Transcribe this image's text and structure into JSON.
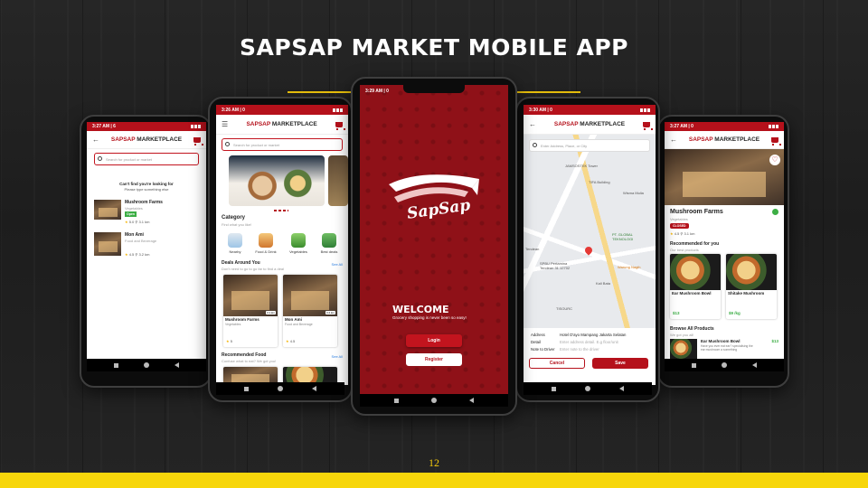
{
  "slide": {
    "title": "SAPSAP MARKET MOBILE APP",
    "page_number": "12",
    "colors": {
      "accent": "#f7d60b",
      "brand_red": "#b5111b",
      "background": "#222222"
    }
  },
  "phone1": {
    "time": "3:27 AM | 6",
    "app_title_red": "SAPSAP",
    "app_title_rest": " MARKETPLACE",
    "search_placeholder": "Search for product or market",
    "empty_title": "Can't find you're looking for",
    "empty_subtitle": "Please type something else",
    "results": [
      {
        "name": "Mushroom Farms",
        "category": "Vegetables",
        "status": "Open",
        "rating": "5.0",
        "distance": "3.1 km"
      },
      {
        "name": "Mon Ami",
        "category": "Food and Beverage",
        "rating": "4.5",
        "distance": "3.2 km"
      }
    ]
  },
  "phone2": {
    "time": "3:26 AM | 0",
    "app_title_red": "SAPSAP",
    "app_title_rest": " MARKETPLACE",
    "search_placeholder": "Search for product or market",
    "category_title": "Category",
    "category_subtitle": "Find what you like!",
    "categories": [
      "Nearby",
      "Food & Drink",
      "Vegetables",
      "Best deals"
    ],
    "deals_title": "Deals Around You",
    "deals_subtitle": "Don't need to go to go far to find a deal",
    "see_all": "See All",
    "deals": [
      {
        "name": "Mushroom Farms",
        "category": "Vegetables",
        "rating": "5",
        "distance": "3.1 km"
      },
      {
        "name": "Mon Ami",
        "category": "Food and Beverage",
        "rating": "4.5",
        "distance": "3.2 km"
      }
    ],
    "recommended_title": "Recommended Food",
    "recommended_subtitle": "Confuse what to eat? We got you!"
  },
  "phone3": {
    "time": "3:29 AM | 0",
    "logo_text": "SapSap",
    "welcome_title": "WELCOME",
    "welcome_subtitle": "Grocery shopping is never been so easy!",
    "login_label": "Login",
    "register_label": "Register"
  },
  "phone4": {
    "time": "3:30 AM | 0",
    "app_title_red": "SAPSAP",
    "app_title_rest": " MARKETPLACE",
    "search_placeholder": "Enter Address, Place, or City",
    "map_labels": [
      "JAMSOSTEK Tower",
      "TIFA Building",
      "Wisma Mulia",
      "PT. GLOBAL TEKNOLOGI",
      "SPBU Pertamina Tendean 31.12702",
      "Warung Nagih",
      "Kali Bata",
      "Tendean",
      "TISOURC"
    ],
    "address_label": "Address",
    "address_value": "Hotel D'ayo Mampang Jakarta Selatan",
    "detail_label": "Detail",
    "detail_placeholder": "Enter address detail. E.g floor/unit",
    "note_label": "Note to Driver",
    "note_placeholder": "Enter note to the driver",
    "cancel_label": "Cancel",
    "save_label": "Save"
  },
  "phone5": {
    "time": "3:27 AM | 0",
    "app_title_red": "SAPSAP",
    "app_title_rest": " MARKETPLACE",
    "store_name": "Mushroom Farms",
    "store_category": "Vegetables",
    "status": "CLOSED",
    "rating": "4.5",
    "distance": "3.1 km",
    "recommended_title": "Recommended for you",
    "recommended_subtitle": "Our best products",
    "products": [
      {
        "name": "Ear Mushroom Bowl",
        "price": "$13"
      },
      {
        "name": "Shitake Mushroom",
        "price": "$9 /kg"
      }
    ],
    "browse_title": "Browse All Products",
    "browse_subtitle": "We got you all!",
    "browse_item_name": "Ear Mushroom Bowl",
    "browse_item_price": "$13",
    "browse_item_desc": "Have you ever eat ear? specialising the ear mushroom a something"
  }
}
